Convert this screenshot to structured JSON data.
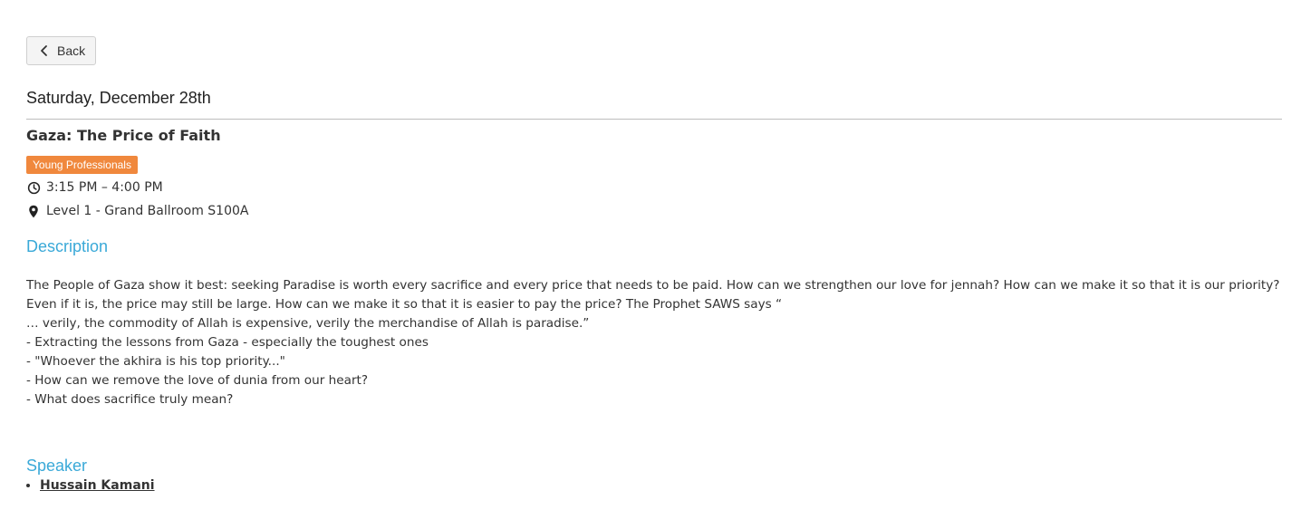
{
  "back_button": {
    "label": "Back",
    "icon": "chevron-left-icon"
  },
  "day_heading": "Saturday, December 28th",
  "session": {
    "title": "Gaza: The Price of Faith",
    "badge": {
      "label": "Young Professionals",
      "color": "#f0883d"
    },
    "time": "3:15 PM – 4:00 PM",
    "location": "Level 1 - Grand Ballroom S100A"
  },
  "description": {
    "heading": "Description",
    "lines": [
      "The People of Gaza show it best: seeking Paradise is worth every sacrifice and every price that needs to be paid. How can we strengthen our love for jennah? How can we make it so that it is our priority? Even if it is, the price may still be large. How can we make it so that it is easier to pay the price? The Prophet SAWS says “",
      "… verily, the commodity of Allah is expensive, verily the merchandise of Allah is paradise.”",
      "- Extracting the lessons from Gaza - especially the toughest ones",
      "- \"Whoever the akhira is his top priority...\"",
      "- How can we remove the love of dunia from our heart?",
      "- What does sacrifice truly mean?"
    ]
  },
  "speakers": {
    "heading": "Speaker",
    "items": [
      "Hussain Kamani"
    ]
  },
  "colors": {
    "accent": "#3aa9d8",
    "badge": "#f0883d"
  }
}
